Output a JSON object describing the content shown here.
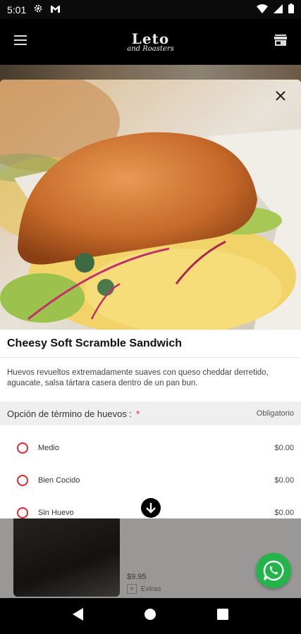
{
  "status_bar": {
    "time": "5:01",
    "icons": [
      "settings-icon",
      "gmail-icon",
      "wifi-icon",
      "signal-icon",
      "battery-icon"
    ]
  },
  "app_bar": {
    "brand_line1": "Leto",
    "brand_line2": "and Roasters",
    "menu_icon": "hamburger-menu-icon",
    "store_icon": "store-icon"
  },
  "background": {
    "price": "$9.95",
    "extras_label": "Extras"
  },
  "product": {
    "title": "Cheesy Soft Scramble Sandwich",
    "description": "Huevos revueltos extremadamente suaves con queso cheddar derretido, aguacate, salsa tártara casera dentro de un pan bun.",
    "options_section": {
      "label": "Opción de término de huevos :",
      "required_mark": "*",
      "mandatory_label": "Obligatorio",
      "options": [
        {
          "name": "Medio",
          "price": "$0.00"
        },
        {
          "name": "Bien Cocido",
          "price": "$0.00"
        },
        {
          "name": "Sin Huevo",
          "price": "$0.00"
        }
      ]
    }
  },
  "colors": {
    "accent": "#e0262e",
    "whatsapp": "#25b34b"
  }
}
